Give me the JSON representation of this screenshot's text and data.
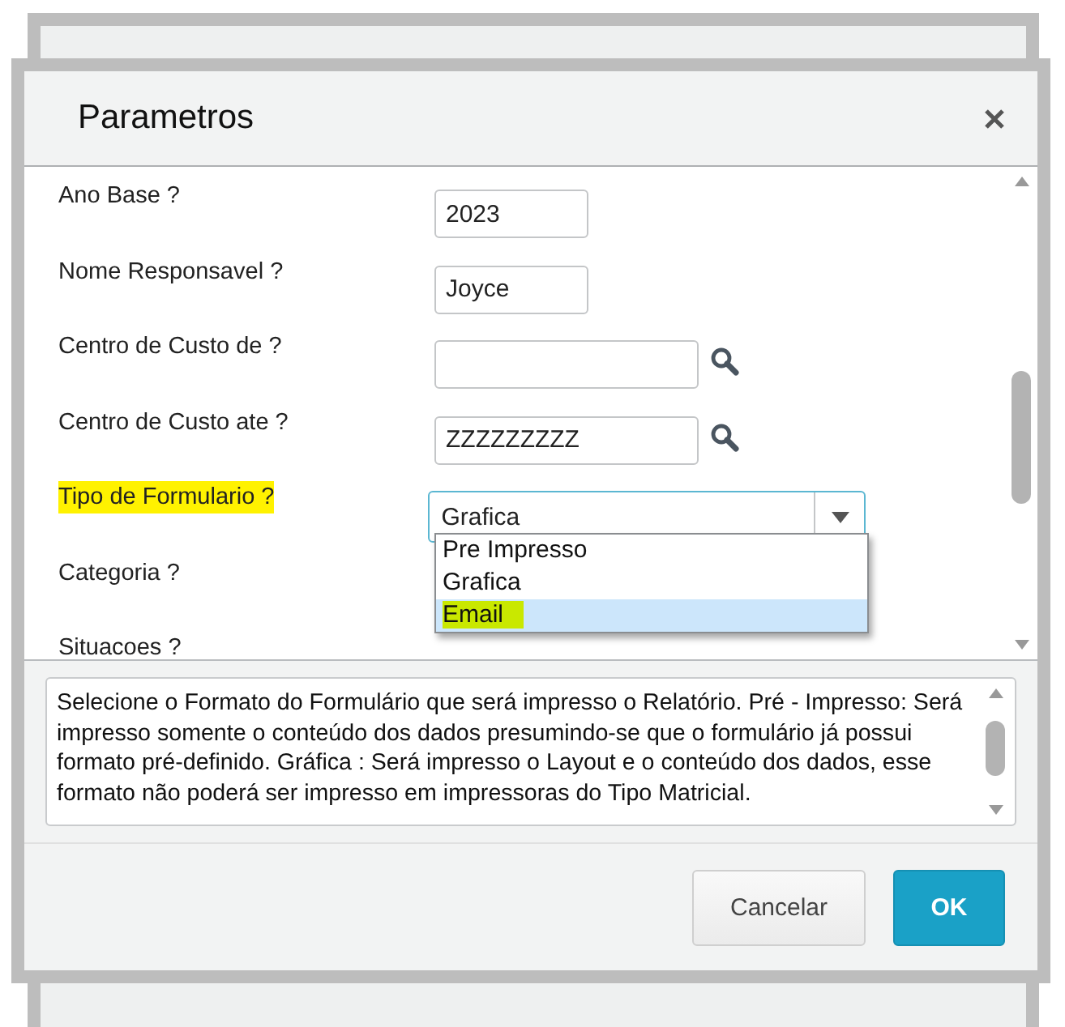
{
  "dialog": {
    "title": "Parametros"
  },
  "fields": [
    {
      "kind": "text",
      "label": "Ano Base ?",
      "value": "2023",
      "highlighted": false
    },
    {
      "kind": "text",
      "label": "Nome Responsavel ?",
      "value": "Joyce",
      "highlighted": false
    },
    {
      "kind": "lookup",
      "label": "Centro de Custo de ?",
      "highlighted": false
    },
    {
      "kind": "lookup",
      "label": "Centro de Custo ate ?",
      "value": "ZZZZZZZZZ",
      "highlighted": false
    },
    {
      "kind": "select",
      "label": "Tipo de Formulario ?",
      "value": "Grafica",
      "highlighted": true
    },
    {
      "kind": "label",
      "label": "Categoria ?",
      "highlighted": false
    },
    {
      "kind": "label",
      "label": "Situacoes ?",
      "highlighted": false
    }
  ],
  "dropdown": {
    "options": [
      {
        "label": "Pre Impresso",
        "selected": false,
        "highlighted": false
      },
      {
        "label": "Grafica",
        "selected": false,
        "highlighted": false
      },
      {
        "label": "Email",
        "selected": true,
        "highlighted": true
      }
    ]
  },
  "help_text": "Selecione o Formato do Formulário que será impresso o Relatório. Pré - Impresso: Será impresso somente o conteúdo dos dados presumindo-se que o formulário já possui formato pré-definido. Gráfica : Será  impresso o Layout e o conteúdo dos dados, esse formato não poderá ser impresso em impressoras do Tipo Matricial.",
  "buttons": [
    {
      "kind": "secondary",
      "label": "Cancelar"
    },
    {
      "kind": "primary",
      "label": "OK"
    }
  ]
}
